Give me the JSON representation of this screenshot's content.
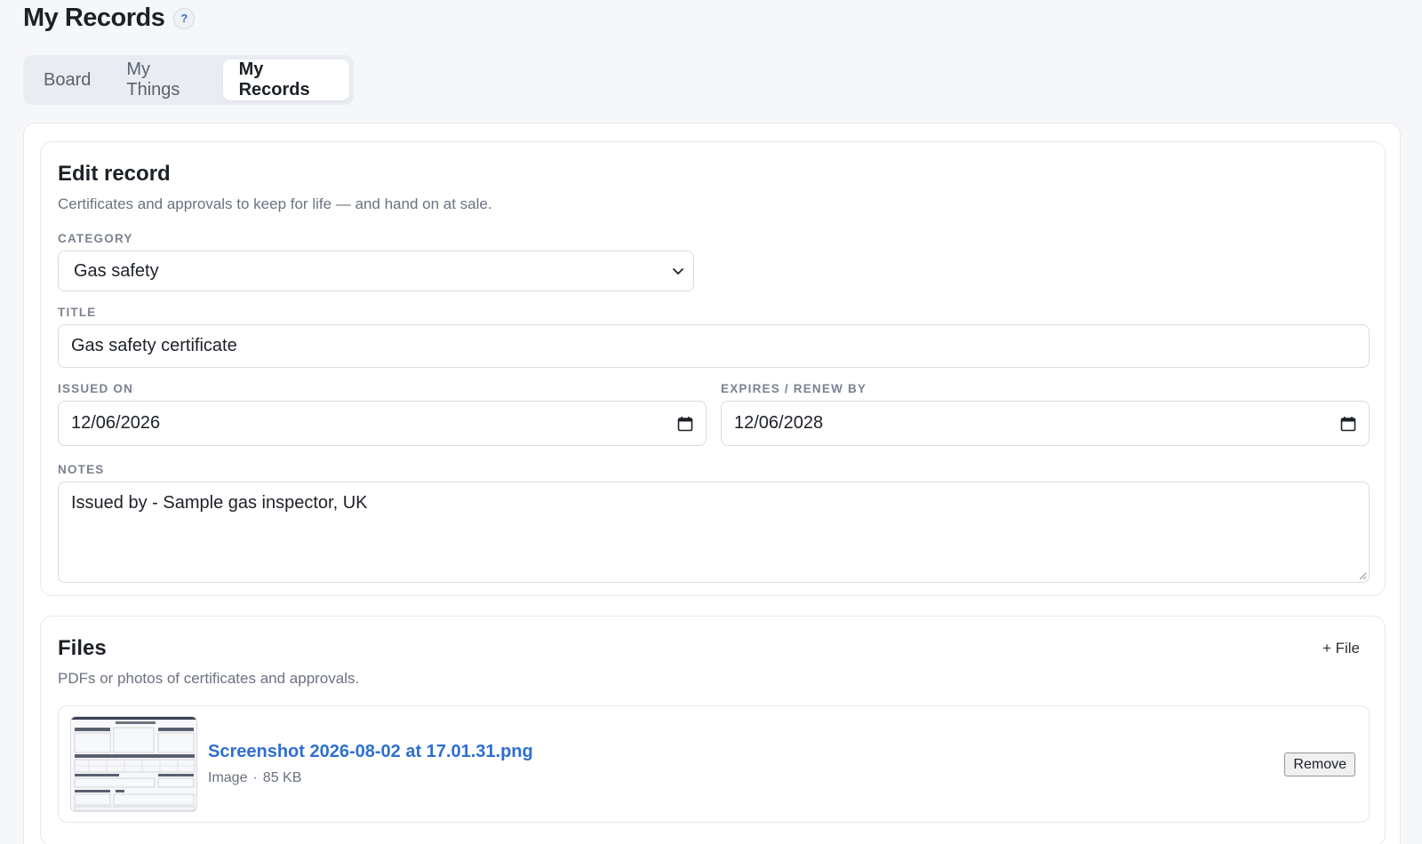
{
  "header": {
    "title": "My Records",
    "help_label": "?"
  },
  "tabs": [
    {
      "label": "Board",
      "active": false
    },
    {
      "label": "My Things",
      "active": false
    },
    {
      "label": "My Records",
      "active": true
    }
  ],
  "edit": {
    "title": "Edit record",
    "subtitle": "Certificates and approvals to keep for life — and hand on at sale.",
    "category": {
      "label": "CATEGORY",
      "value": "Gas safety"
    },
    "record_title": {
      "label": "TITLE",
      "value": "Gas safety certificate"
    },
    "issued_on": {
      "label": "ISSUED ON",
      "value": "12/06/2026"
    },
    "expires": {
      "label": "EXPIRES / RENEW BY",
      "value": "12/06/2028"
    },
    "notes": {
      "label": "NOTES",
      "value": "Issued by - Sample gas inspector, UK"
    }
  },
  "files": {
    "title": "Files",
    "subtitle": "PDFs or photos of certificates and approvals.",
    "add_label": "+ File",
    "items": [
      {
        "name": "Screenshot 2026-08-02 at 17.01.31.png",
        "type": "Image",
        "separator": "·",
        "size": "85 KB",
        "remove_label": "Remove"
      }
    ]
  },
  "colors": {
    "accent": "#2f6fd0",
    "page_bg": "#f6f7f9",
    "border": "#e6e9ee"
  },
  "icons": {
    "help": "question-icon",
    "select": "chevron-down-icon",
    "date": "calendar-icon",
    "resize": "resize-grip-icon"
  }
}
